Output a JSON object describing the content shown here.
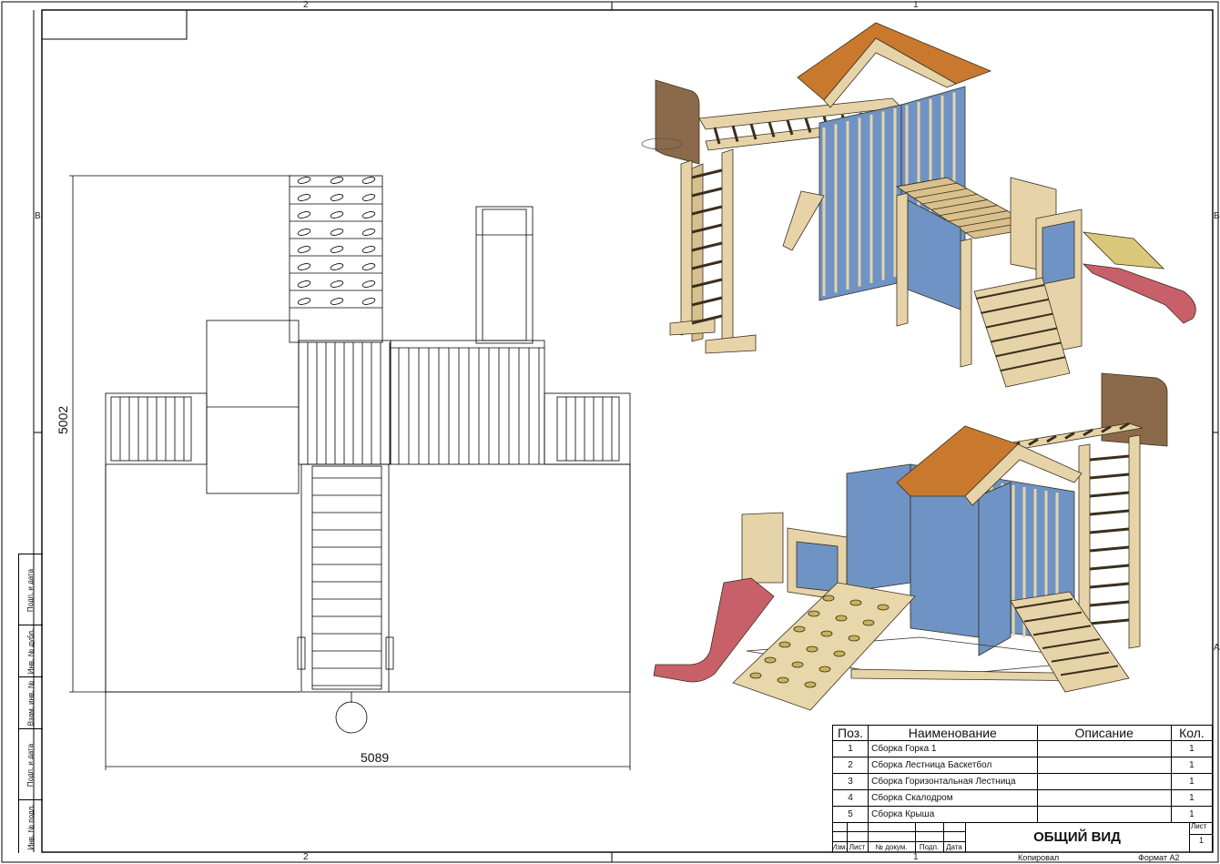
{
  "sheet": {
    "zone_top": "2",
    "zone_top_right": "1",
    "zone_bottom": "2",
    "zone_bottom_right": "1",
    "zone_left_b": "B",
    "zone_right_b": "B",
    "zone_right_a": "A"
  },
  "side_stamp": {
    "cells": [
      "Подп. и дата",
      "Инв. № дубл.",
      "Взам. инв. №",
      "Подп. и дата",
      "Инв. № подл."
    ]
  },
  "plan_view": {
    "dim_height": "5002",
    "dim_width": "5089"
  },
  "colors": {
    "wood": "#e6d3a8",
    "wood_dark": "#b89a64",
    "panel_blue": "#6f93c4",
    "roof": "#c8792e",
    "slide": "#c8606a",
    "hoop_board": "#8a6a4a"
  },
  "bom": {
    "headers": [
      "Поз.",
      "Наименование",
      "Описание",
      "Кол."
    ],
    "rows": [
      {
        "pos": "1",
        "name": "Сборка Горка 1",
        "desc": "",
        "qty": "1"
      },
      {
        "pos": "2",
        "name": "Сборка Лестница Баскетбол",
        "desc": "",
        "qty": "1"
      },
      {
        "pos": "3",
        "name": "Сборка Горизонтальная Лестница",
        "desc": "",
        "qty": "1"
      },
      {
        "pos": "4",
        "name": "Сборка Скалодром",
        "desc": "",
        "qty": "1"
      },
      {
        "pos": "5",
        "name": "Сборка Крыша",
        "desc": "",
        "qty": "1"
      }
    ]
  },
  "title_block": {
    "title": "ОБЩИЙ ВИД",
    "sheet_label": "Лист",
    "sheet_number": "1",
    "cols": [
      "Изм.",
      "Лист",
      "№ докум.",
      "Подп.",
      "Дата"
    ],
    "copied": "Копировал",
    "format": "Формат А2"
  }
}
